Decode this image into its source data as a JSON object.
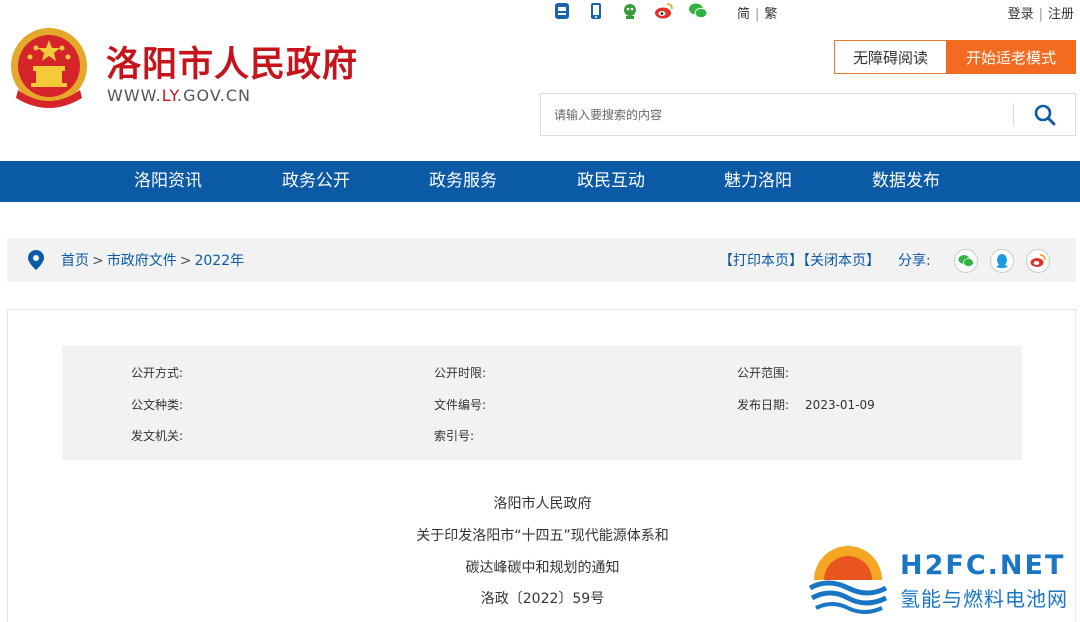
{
  "header": {
    "title": "洛阳市人民政府",
    "url_prefix": "WWW.",
    "url_highlight": "LY",
    "url_suffix": ".GOV.CN",
    "lang_simplified": "简",
    "lang_traditional": "繁",
    "login": "登录",
    "register": "注册",
    "separator": "|",
    "access_button": "无障碍阅读",
    "elder_button": "开始适老模式",
    "top_icons": [
      "app-icon",
      "mobile-icon",
      "robot-icon",
      "weibo-icon",
      "wechat-icon"
    ]
  },
  "search": {
    "placeholder": "请输入要搜索的内容",
    "value": ""
  },
  "nav": {
    "items": [
      "洛阳资讯",
      "政务公开",
      "政务服务",
      "政民互动",
      "魅力洛阳",
      "数据发布"
    ]
  },
  "breadcrumb": {
    "items": [
      "首页",
      "市政府文件",
      "2022年"
    ],
    "arrow": ">",
    "print": "【打印本页】",
    "close": "【关闭本页】",
    "share": "分享:",
    "share_icons": [
      "wechat-icon",
      "qq-icon",
      "weibo-icon"
    ]
  },
  "meta": {
    "open_method": {
      "label": "公开方式:",
      "value": ""
    },
    "open_period": {
      "label": "公开时限:",
      "value": ""
    },
    "open_scope": {
      "label": "公开范围:",
      "value": ""
    },
    "doc_type": {
      "label": "公文种类:",
      "value": ""
    },
    "doc_number": {
      "label": "文件编号:",
      "value": ""
    },
    "publish_date": {
      "label": "发布日期:",
      "value": "2023-01-09"
    },
    "issuer": {
      "label": "发文机关:",
      "value": ""
    },
    "index_number": {
      "label": "索引号:",
      "value": ""
    }
  },
  "document": {
    "issuer": "洛阳市人民政府",
    "title_line1": "关于印发洛阳市“十四五”现代能源体系和",
    "title_line2": "碳达峰碳中和规划的通知",
    "doc_no": "洛政〔2022〕59号"
  },
  "watermark": {
    "name": "H2FC.NET",
    "subtitle": "氢能与燃料电池网"
  },
  "colors": {
    "brand_red": "#c5141b",
    "nav_blue": "#0b5aa5",
    "elder_orange": "#f26b21",
    "watermark_blue": "#1876c5"
  }
}
